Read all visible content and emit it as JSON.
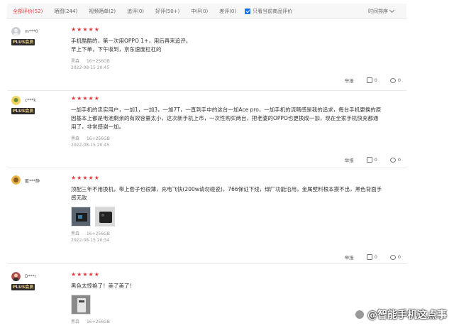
{
  "filters": {
    "tabs": [
      "全部评价(52)",
      "晒图(244)",
      "视频晒单(2)",
      "追评(0)",
      "好评(50+)",
      "中评(0)",
      "差评(0)"
    ],
    "only_current": "只看当前商品评价",
    "sort": "时间排序"
  },
  "reviews": [
    {
      "user": "m***0",
      "badge": "PLUS会员",
      "stars": 5,
      "text_lines": [
        "手机酷酷的，第一次用OPPO 1+，用后再来追评。",
        "早上下单，下午收到，京东速度杠杠的"
      ],
      "color": "黑森",
      "spec": "16+256GB",
      "date": "2022-08-15 20:45",
      "report": "举报",
      "likes": "0",
      "comments": "0"
    },
    {
      "user": "c***k",
      "badge": "PLUS会员",
      "stars": 5,
      "text_lines": [
        "一加手机的忠实用户，一加1，一加3，一加7T，一直到手中的这台一加Ace pro，一加手机的流畅感是我的追求，每台手机更换的原",
        "因基本上都是电池剩余的有效容量太小，这次新手机上市，一次性购买两台，把老婆的OPPO也更换成一加，现在全家手机快充都通",
        "用了，非常感谢一加。"
      ],
      "color": "黑森",
      "spec": "16+256GB",
      "date": "2022-08-15 20:45",
      "report": "举报",
      "likes": "0",
      "comments": "0"
    },
    {
      "user": "匿***静",
      "badge": "",
      "stars": 5,
      "text_lines": [
        "顶配三年不用换机，带上套子也很薄，充电飞快(200w请勿碰瓷)，766保证下线，绿厂功能沿用，金属壁料根本摸不出，黑色背面手",
        "感无敌"
      ],
      "color": "黑森",
      "spec": "16+256GB",
      "date": "2022-08-15 20:34",
      "report": "举报",
      "likes": "0",
      "comments": "0"
    },
    {
      "user": "D***r",
      "badge": "PLUS会员",
      "stars": 5,
      "text_lines": [
        "黑色太惊艳了！美了美了！"
      ],
      "color": "黑森",
      "spec": "16+256GB",
      "date": "",
      "report": "",
      "likes": "",
      "comments": ""
    }
  ],
  "watermark": "@智能手机这点事"
}
